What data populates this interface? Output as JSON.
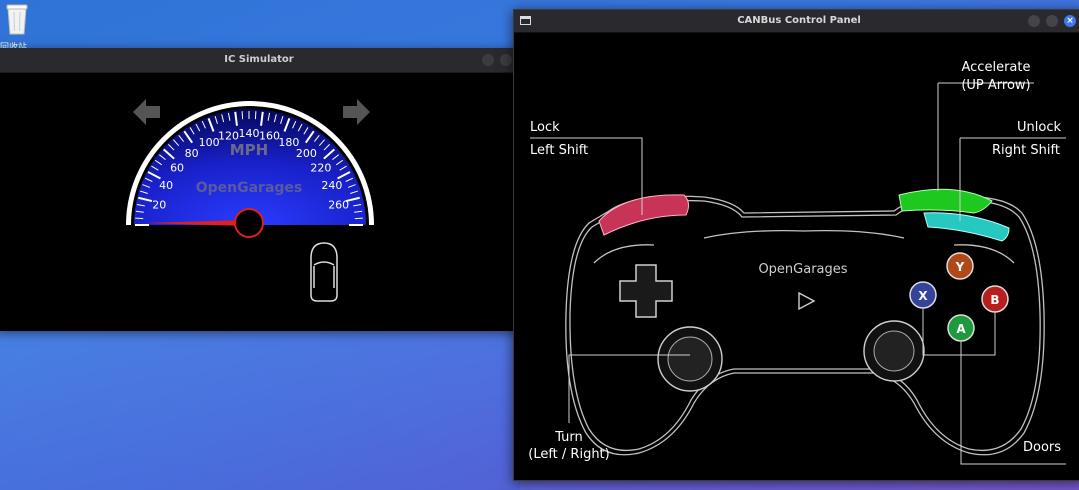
{
  "desktop": {
    "icon_label": "回收站"
  },
  "ic_window": {
    "title": "IC Simulator",
    "speedometer": {
      "unit": "MPH",
      "brand": "OpenGarages",
      "ticks": [
        "20",
        "40",
        "60",
        "80",
        "100",
        "120",
        "140",
        "160",
        "180",
        "200",
        "220",
        "240",
        "260"
      ],
      "current_speed": 0
    }
  },
  "can_window": {
    "title": "CANBus Control Panel",
    "controller_brand": "OpenGarages",
    "labels": {
      "lock": "Lock",
      "lock_key": "Left Shift",
      "accelerate": "Accelerate",
      "accelerate_key": "(UP Arrow)",
      "unlock": "Unlock",
      "unlock_key": "Right Shift",
      "turn": "Turn",
      "turn_keys": "(Left / Right)",
      "doors": "Doors"
    },
    "buttons": {
      "y": "Y",
      "x": "X",
      "b": "B",
      "a": "A"
    }
  },
  "colors": {
    "gauge_blue": "#1a22c8",
    "needle_red": "#e0201a",
    "lb_pink": "#e0406a",
    "rt_green": "#2adf2a",
    "rb_cyan": "#30e0d8",
    "btn_y": "#c0501a",
    "btn_x": "#3a4aa0",
    "btn_b": "#c02020",
    "btn_a": "#20a040"
  }
}
